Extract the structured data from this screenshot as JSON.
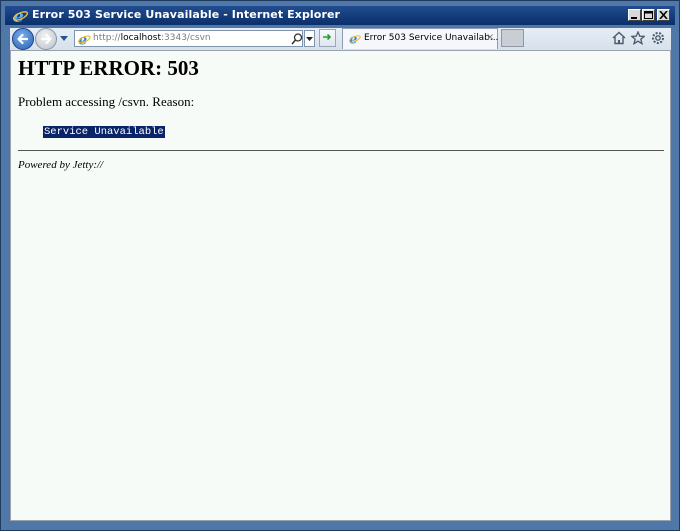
{
  "window": {
    "title": "Error 503 Service Unavailable - Internet Explorer",
    "minimize_label": "Minimize",
    "maximize_label": "Maximize",
    "close_label": "Close"
  },
  "toolbar": {
    "url_prefix": "http://",
    "url_host": "localhost",
    "url_rest": ":3343/csvn",
    "tab_title": "Error 503 Service Unavailab...",
    "tab_close": "×"
  },
  "page": {
    "heading": "HTTP ERROR: 503",
    "problem_text": "Problem accessing /csvn. Reason:",
    "reason": "Service Unavailable",
    "powered_by": "Powered by Jetty://"
  },
  "colors": {
    "titlebar": "#0b2f6a",
    "frame": "#4f78a8",
    "page_bg": "#f7fbf8",
    "reason_bg": "#0a2469"
  },
  "icons": [
    "ie-logo-icon",
    "back-arrow-icon",
    "forward-arrow-icon",
    "dropdown-icon",
    "search-icon",
    "refresh-icon",
    "home-icon",
    "star-icon",
    "gear-icon"
  ]
}
